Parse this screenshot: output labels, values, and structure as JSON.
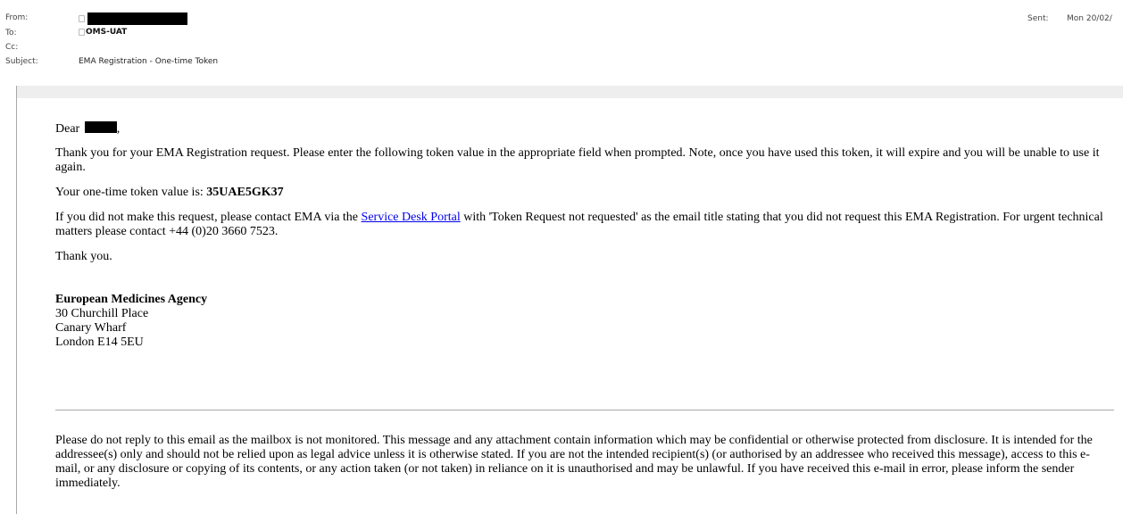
{
  "header": {
    "from_label": "From:",
    "to_label": "To:",
    "to_value": "OMS-UAT",
    "cc_label": "Cc:",
    "subject_label": "Subject:",
    "subject_value": "EMA Registration - One-time Token",
    "sent_label": "Sent:",
    "sent_value": "Mon 20/02/"
  },
  "body": {
    "greeting_prefix": "Dear ",
    "greeting_suffix": ",",
    "intro": "Thank you for your EMA Registration request. Please enter the following token value in the appropriate field when prompted. Note, once you have used this token, it will expire and you will be unable to use it again.",
    "token_label": "Your one-time token value is: ",
    "token_value": "35UAE5GK37",
    "contact_prefix": "If you did not make this request, please contact EMA via the ",
    "contact_link": "Service Desk Portal",
    "contact_suffix": " with 'Token Request not requested' as the email title stating that you did not request this EMA Registration. For urgent technical matters please contact +44 (0)20 3660 7523.",
    "thanks": "Thank you.",
    "signature": {
      "name": "European Medicines Agency",
      "address_line1": "30 Churchill Place",
      "address_line2": "Canary Wharf",
      "address_line3": "London E14 5EU"
    },
    "disclaimer": "Please do not reply to this email as the mailbox is not monitored. This message and any attachment contain information which may be confidential or otherwise protected from disclosure. It is intended for the addressee(s) only and should not be relied upon as legal advice unless it is otherwise stated. If you are not the intended recipient(s) (or authorised by an addressee who received this message), access to this e-mail, or any disclosure or copying of its contents, or any action taken (or not taken) in reliance on it is unauthorised and may be unlawful. If you have received this e-mail in error, please inform the sender immediately."
  }
}
